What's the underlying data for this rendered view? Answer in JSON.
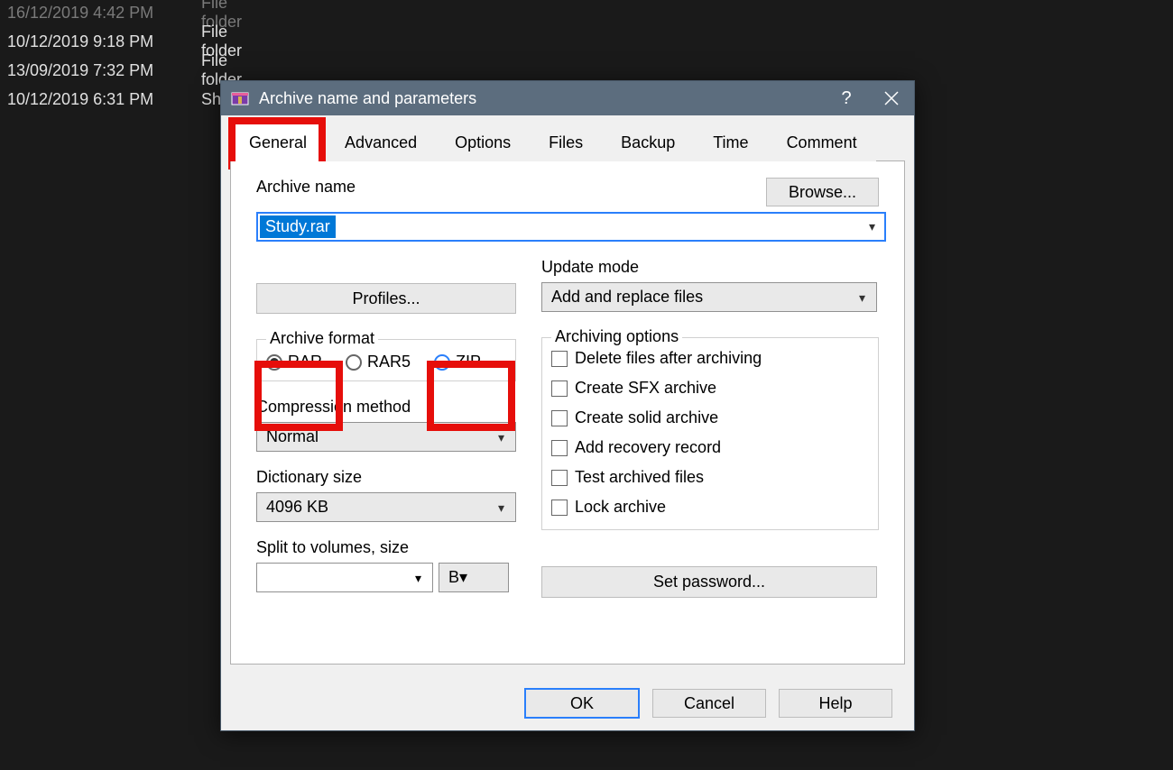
{
  "background": {
    "rows": [
      {
        "date": "16/12/2019 4:42 PM",
        "type": "File folder",
        "dim": true
      },
      {
        "date": "10/12/2019 9:18 PM",
        "type": "File folder",
        "dim": false
      },
      {
        "date": "13/09/2019 7:32 PM",
        "type": "File folder",
        "dim": false
      },
      {
        "date": "10/12/2019 6:31 PM",
        "type": "Sh",
        "dim": false
      }
    ]
  },
  "dialog": {
    "title": "Archive name and parameters",
    "tabs": [
      "General",
      "Advanced",
      "Options",
      "Files",
      "Backup",
      "Time",
      "Comment"
    ],
    "active_tab": 0,
    "labels": {
      "archive_name": "Archive name",
      "browse": "Browse...",
      "profiles": "Profiles...",
      "update_mode": "Update mode",
      "archive_format": "Archive format",
      "comp_method": "Compression method",
      "dict_size": "Dictionary size",
      "split": "Split to volumes, size",
      "archiving_options": "Archiving options",
      "set_password": "Set password..."
    },
    "archive_name_value": "Study.rar",
    "update_mode_value": "Add and replace files",
    "formats": {
      "rar": "RAR",
      "rar5": "RAR5",
      "zip": "ZIP",
      "selected": "rar"
    },
    "comp_value": "Normal",
    "dict_value": "4096 KB",
    "split_value": "",
    "split_unit": "B",
    "check_options": [
      "Delete files after archiving",
      "Create SFX archive",
      "Create solid archive",
      "Add recovery record",
      "Test archived files",
      "Lock archive"
    ],
    "buttons": {
      "ok": "OK",
      "cancel": "Cancel",
      "help": "Help"
    }
  }
}
